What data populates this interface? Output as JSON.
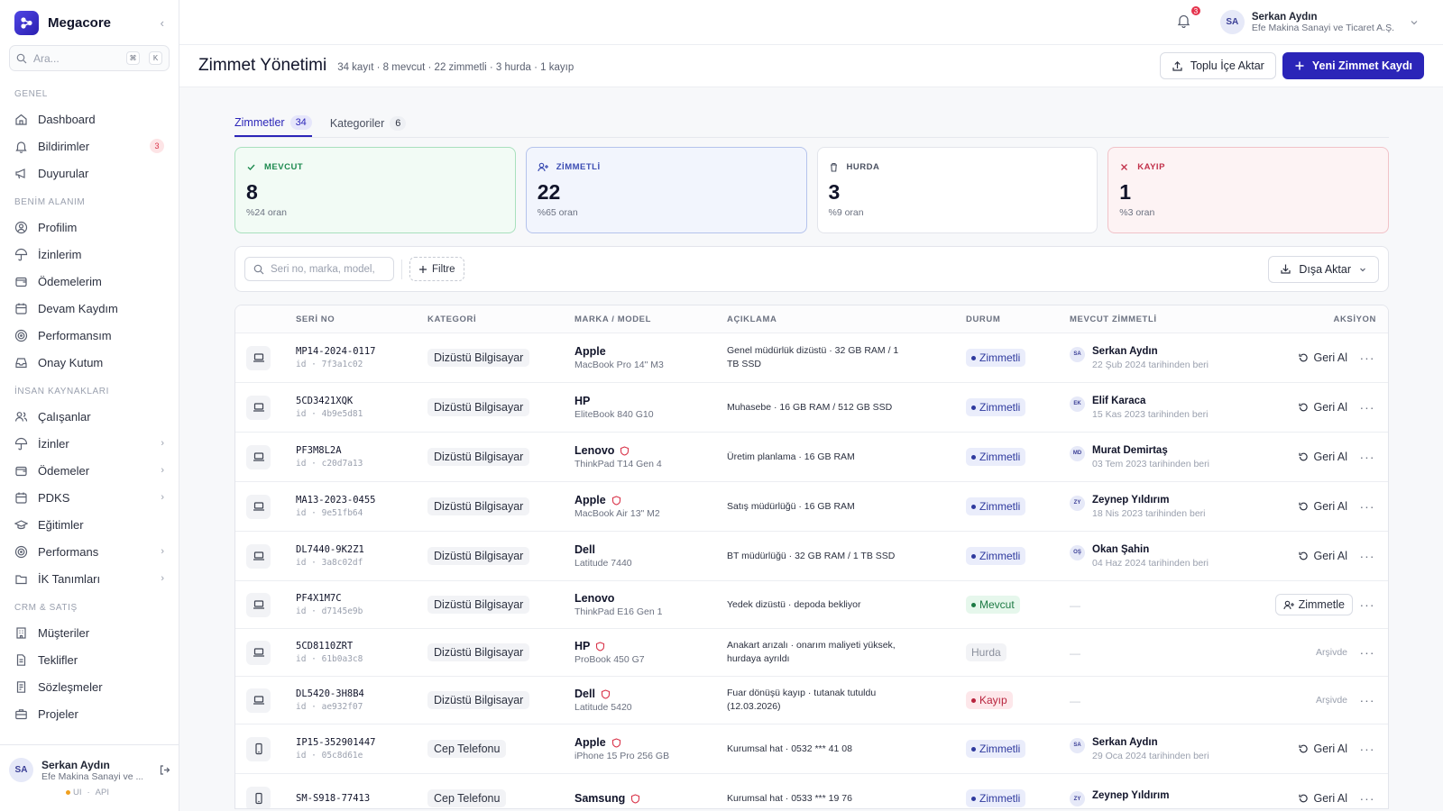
{
  "app": {
    "name": "Megacore",
    "search_placeholder": "Ara...",
    "kbd_1": "⌘",
    "kbd_2": "K"
  },
  "sidebar": {
    "sections": [
      {
        "title": "GENEL",
        "items": [
          {
            "label": "Dashboard",
            "icon": "home-icon"
          },
          {
            "label": "Bildirimler",
            "icon": "bell-icon",
            "badge": "3"
          },
          {
            "label": "Duyurular",
            "icon": "megaphone-icon"
          }
        ]
      },
      {
        "title": "BENİM ALANIM",
        "items": [
          {
            "label": "Profilim",
            "icon": "user-circle-icon"
          },
          {
            "label": "İzinlerim",
            "icon": "umbrella-icon"
          },
          {
            "label": "Ödemelerim",
            "icon": "wallet-icon"
          },
          {
            "label": "Devam Kaydım",
            "icon": "calendar-icon"
          },
          {
            "label": "Performansım",
            "icon": "target-icon"
          },
          {
            "label": "Onay Kutum",
            "icon": "inbox-icon"
          }
        ]
      },
      {
        "title": "İNSAN KAYNAKLARI",
        "items": [
          {
            "label": "Çalışanlar",
            "icon": "users-icon"
          },
          {
            "label": "İzinler",
            "icon": "umbrella-icon",
            "chevron": true
          },
          {
            "label": "Ödemeler",
            "icon": "wallet-icon",
            "chevron": true
          },
          {
            "label": "PDKS",
            "icon": "calendar-icon",
            "chevron": true
          },
          {
            "label": "Eğitimler",
            "icon": "graduation-icon"
          },
          {
            "label": "Performans",
            "icon": "target-icon",
            "chevron": true
          },
          {
            "label": "İK Tanımları",
            "icon": "folder-icon",
            "chevron": true
          }
        ]
      },
      {
        "title": "CRM & SATIŞ",
        "items": [
          {
            "label": "Müşteriler",
            "icon": "building-icon"
          },
          {
            "label": "Teklifler",
            "icon": "document-icon"
          },
          {
            "label": "Sözleşmeler",
            "icon": "contract-icon"
          },
          {
            "label": "Projeler",
            "icon": "briefcase-icon"
          }
        ]
      }
    ],
    "user": {
      "initials": "SA",
      "name": "Serkan Aydın",
      "org": "Efe Makina Sanayi ve ...",
      "env_ui": "UI",
      "env_api": "API"
    }
  },
  "topbar": {
    "notif_count": "3",
    "user_initials": "SA",
    "user_name": "Serkan Aydın",
    "user_org": "Efe Makina Sanayi ve Ticaret A.Ş."
  },
  "page": {
    "title": "Zimmet Yönetimi",
    "stats": "34 kayıt · 8 mevcut · 22 zimmetli · 3 hurda · 1 kayıp",
    "import_label": "Toplu İçe Aktar",
    "new_label": "Yeni Zimmet Kaydı"
  },
  "tabs": [
    {
      "label": "Zimmetler",
      "count": "34"
    },
    {
      "label": "Kategoriler",
      "count": "6"
    }
  ],
  "cards": [
    {
      "title": "MEVCUT",
      "value": "8",
      "sub": "%24 oran"
    },
    {
      "title": "ZİMMETLİ",
      "value": "22",
      "sub": "%65 oran"
    },
    {
      "title": "HURDA",
      "value": "3",
      "sub": "%9 oran"
    },
    {
      "title": "KAYIP",
      "value": "1",
      "sub": "%3 oran"
    }
  ],
  "toolbar": {
    "search_placeholder": "Seri no, marka, model,",
    "filter_label": "Filtre",
    "export_label": "Dışa Aktar"
  },
  "table": {
    "headers": {
      "serial": "SERİ NO",
      "category": "KATEGORİ",
      "brand": "MARKA / MODEL",
      "desc": "AÇIKLAMA",
      "status": "DURUM",
      "user": "MEVCUT ZİMMETLİ",
      "action": "AKSİYON"
    },
    "rows": [
      {
        "device": "laptop",
        "serial": "MP14-2024-0117",
        "id": "id · 7f3a1c02",
        "category": "Dizüstü Bilgisayar",
        "brand": "Apple",
        "shield": false,
        "model": "MacBook Pro 14\" M3",
        "desc": "Genel müdürlük dizüstü · 32 GB RAM / 1 TB SSD",
        "status": "Zimmetli",
        "user_initials": "SA",
        "user": "Serkan Aydın",
        "since": "22 Şub 2024 tarihinden beri",
        "action": "Geri Al"
      },
      {
        "device": "laptop",
        "serial": "5CD3421XQK",
        "id": "id · 4b9e5d81",
        "category": "Dizüstü Bilgisayar",
        "brand": "HP",
        "shield": false,
        "model": "EliteBook 840 G10",
        "desc": "Muhasebe · 16 GB RAM / 512 GB SSD",
        "status": "Zimmetli",
        "user_initials": "EK",
        "user": "Elif Karaca",
        "since": "15 Kas 2023 tarihinden beri",
        "action": "Geri Al"
      },
      {
        "device": "laptop",
        "serial": "PF3M8L2A",
        "id": "id · c20d7a13",
        "category": "Dizüstü Bilgisayar",
        "brand": "Lenovo",
        "shield": true,
        "model": "ThinkPad T14 Gen 4",
        "desc": "Üretim planlama · 16 GB RAM",
        "status": "Zimmetli",
        "user_initials": "MD",
        "user": "Murat Demirtaş",
        "since": "03 Tem 2023 tarihinden beri",
        "action": "Geri Al"
      },
      {
        "device": "laptop",
        "serial": "MA13-2023-0455",
        "id": "id · 9e51fb64",
        "category": "Dizüstü Bilgisayar",
        "brand": "Apple",
        "shield": true,
        "model": "MacBook Air 13\" M2",
        "desc": "Satış müdürlüğü · 16 GB RAM",
        "status": "Zimmetli",
        "user_initials": "ZY",
        "user": "Zeynep Yıldırım",
        "since": "18 Nis 2023 tarihinden beri",
        "action": "Geri Al"
      },
      {
        "device": "laptop",
        "serial": "DL7440-9K2Z1",
        "id": "id · 3a8c02df",
        "category": "Dizüstü Bilgisayar",
        "brand": "Dell",
        "shield": false,
        "model": "Latitude 7440",
        "desc": "BT müdürlüğü · 32 GB RAM / 1 TB SSD",
        "status": "Zimmetli",
        "user_initials": "OŞ",
        "user": "Okan Şahin",
        "since": "04 Haz 2024 tarihinden beri",
        "action": "Geri Al"
      },
      {
        "device": "laptop",
        "serial": "PF4X1M7C",
        "id": "id · d7145e9b",
        "category": "Dizüstü Bilgisayar",
        "brand": "Lenovo",
        "shield": false,
        "model": "ThinkPad E16 Gen 1",
        "desc": "Yedek dizüstü · depoda bekliyor",
        "status": "Mevcut",
        "user_initials": "",
        "user": "",
        "since": "",
        "action": "Zimmetle"
      },
      {
        "device": "laptop",
        "serial": "5CD8110ZRT",
        "id": "id · 61b0a3c8",
        "category": "Dizüstü Bilgisayar",
        "brand": "HP",
        "shield": true,
        "model": "ProBook 450 G7",
        "desc": "Anakart arızalı · onarım maliyeti yüksek, hurdaya ayrıldı",
        "status": "Hurda",
        "user_initials": "",
        "user": "",
        "since": "",
        "action": "Arşivde"
      },
      {
        "device": "laptop",
        "serial": "DL5420-3H8B4",
        "id": "id · ae932f07",
        "category": "Dizüstü Bilgisayar",
        "brand": "Dell",
        "shield": true,
        "model": "Latitude 5420",
        "desc": "Fuar dönüşü kayıp · tutanak tutuldu (12.03.2026)",
        "status": "Kayıp",
        "user_initials": "",
        "user": "",
        "since": "",
        "action": "Arşivde"
      },
      {
        "device": "phone",
        "serial": "IP15-352901447",
        "id": "id · 05c8d61e",
        "category": "Cep Telefonu",
        "brand": "Apple",
        "shield": true,
        "model": "iPhone 15 Pro 256 GB",
        "desc": "Kurumsal hat · 0532 *** 41 08",
        "status": "Zimmetli",
        "user_initials": "SA",
        "user": "Serkan Aydın",
        "since": "29 Oca 2024 tarihinden beri",
        "action": "Geri Al"
      },
      {
        "device": "phone",
        "serial": "SM-S918-77413",
        "id": "",
        "category": "Cep Telefonu",
        "brand": "Samsung",
        "shield": true,
        "model": "",
        "desc": "Kurumsal hat · 0533 *** 19 76",
        "status": "Zimmetli",
        "user_initials": "ZY",
        "user": "Zeynep Yıldırım",
        "since": "",
        "action": "Geri Al"
      }
    ]
  },
  "colors": {
    "accent": "#2b25b8",
    "mevcut": "#1d8a4f",
    "zimmetli": "#3c4db3",
    "kayip": "#c2304a",
    "danger": "#e5344d"
  }
}
